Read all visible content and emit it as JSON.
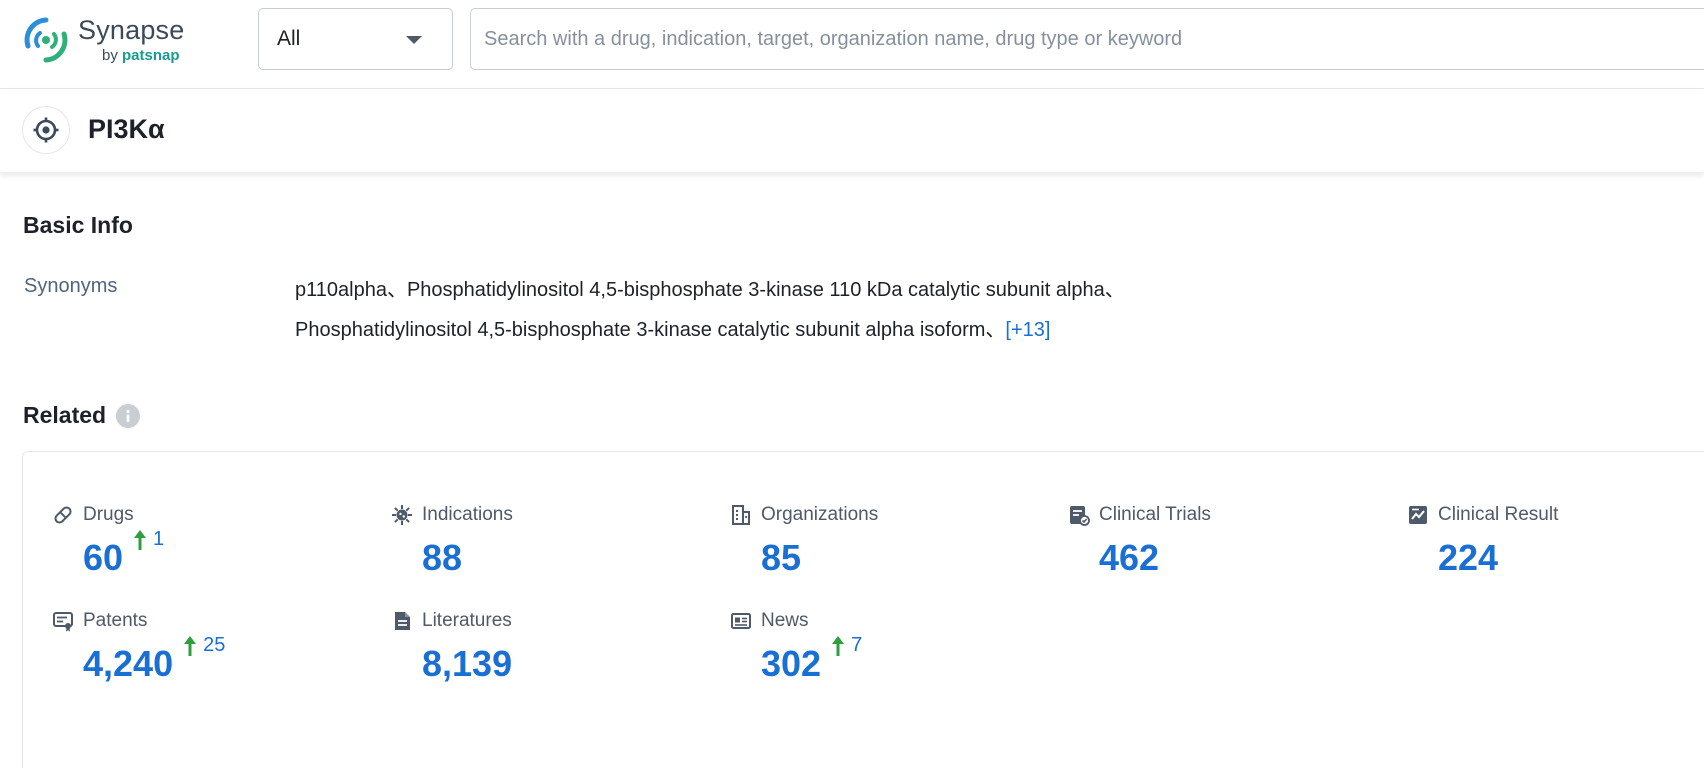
{
  "brand": {
    "name": "Synapse",
    "by_prefix": "by",
    "by_name": "patsnap",
    "colors": {
      "green": "#2fb07a",
      "blue": "#2a8fd8",
      "accent": "#1a6fd4"
    }
  },
  "search": {
    "scope_value": "All",
    "placeholder": "Search with a drug, indication, target, organization name, drug type or keyword",
    "value": ""
  },
  "entity": {
    "icon": "target-icon",
    "title": "PI3Kα"
  },
  "basic_info": {
    "title": "Basic Info",
    "synonyms_label": "Synonyms",
    "synonyms_line1": "p110alpha、Phosphatidylinositol 4,5-bisphosphate 3-kinase 110 kDa catalytic subunit alpha、",
    "synonyms_line2": "Phosphatidylinositol 4,5-bisphosphate 3-kinase catalytic subunit alpha isoform、",
    "synonyms_more": "[+13]"
  },
  "related": {
    "title": "Related",
    "stats": [
      {
        "icon": "pill-icon",
        "label": "Drugs",
        "value": "60",
        "delta": "1"
      },
      {
        "icon": "virus-icon",
        "label": "Indications",
        "value": "88",
        "delta": ""
      },
      {
        "icon": "building-icon",
        "label": "Organizations",
        "value": "85",
        "delta": ""
      },
      {
        "icon": "clinical-trials-icon",
        "label": "Clinical Trials",
        "value": "462",
        "delta": ""
      },
      {
        "icon": "clinical-result-icon",
        "label": "Clinical Result",
        "value": "224",
        "delta": ""
      },
      {
        "icon": "patent-icon",
        "label": "Patents",
        "value": "4,240",
        "delta": "25"
      },
      {
        "icon": "document-icon",
        "label": "Literatures",
        "value": "8,139",
        "delta": ""
      },
      {
        "icon": "news-icon",
        "label": "News",
        "value": "302",
        "delta": "7"
      }
    ]
  }
}
